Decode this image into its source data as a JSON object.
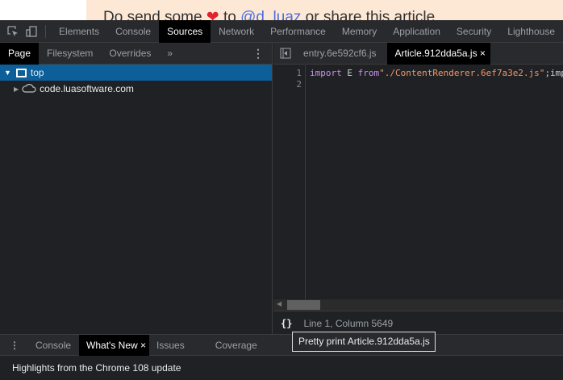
{
  "page": {
    "text_before": "Do send some ",
    "heart": "❤",
    "text_mid": " to ",
    "link": "@d_luaz",
    "text_after": " or share this article"
  },
  "toolbar": {
    "tabs": [
      "Elements",
      "Console",
      "Sources",
      "Network",
      "Performance",
      "Memory",
      "Application",
      "Security",
      "Lighthouse"
    ],
    "active": "Sources"
  },
  "navigator": {
    "tabs": [
      "Page",
      "Filesystem",
      "Overrides"
    ],
    "more": "»",
    "active": "Page",
    "tree": [
      {
        "label": "top",
        "selected": true
      },
      {
        "label": "code.luasoftware.com"
      }
    ]
  },
  "editor": {
    "tabs": [
      {
        "label": "entry.6e592cf6.js"
      },
      {
        "label": "Article.912dda5a.js",
        "active": true,
        "close": "×"
      }
    ],
    "line_numbers": [
      "1",
      "2"
    ],
    "code": {
      "kw1": "import",
      "id": " E ",
      "kw2": "from",
      "str": "\"./ContentRenderer.6ef7a3e2.js\"",
      "rest": ";import"
    }
  },
  "status": {
    "pretty_print_icon": "{}",
    "position": "Line 1, Column 5649"
  },
  "tooltip": "Pretty print Article.912dda5a.js",
  "drawer": {
    "tabs": [
      {
        "label": "Console"
      },
      {
        "label": "What's New",
        "active": true,
        "close": "×"
      },
      {
        "label": "Issues"
      },
      {
        "label": "Coverage"
      }
    ],
    "content": "Highlights from the Chrome 108 update"
  },
  "colors": {
    "selection": "#0d5f99",
    "active_tab": "#000000"
  }
}
